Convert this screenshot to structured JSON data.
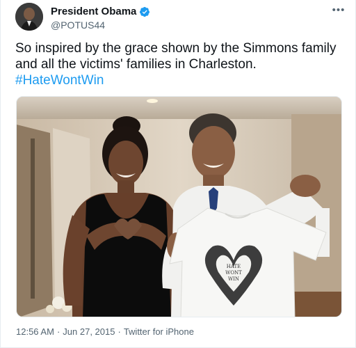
{
  "author": {
    "display_name": "President Obama",
    "handle": "@POTUS44",
    "verified_icon": "verified-badge-icon",
    "avatar_icon": "avatar"
  },
  "menu": {
    "more_label": "•••",
    "icon": "more-icon"
  },
  "tweet": {
    "text": "So inspired by the grace shown by the Simmons family and all the victims' families in Charleston.",
    "hashtag": "#HateWontWin",
    "media_shirt_text": [
      "HATE",
      "WONT",
      "WIN"
    ]
  },
  "footer": {
    "time": "12:56 AM",
    "sep1": "·",
    "date": "Jun 27, 2015",
    "sep2": "·",
    "source": "Twitter for iPhone"
  },
  "colors": {
    "accent": "#1d9bf0",
    "text": "#0f1419",
    "muted": "#536471"
  }
}
